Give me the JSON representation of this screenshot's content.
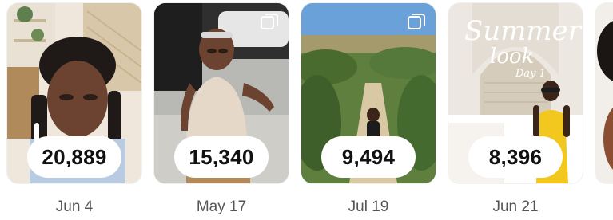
{
  "posts": [
    {
      "count": "20,889",
      "date": "Jun 4",
      "multi": false,
      "overlay": null
    },
    {
      "count": "15,340",
      "date": "May 17",
      "multi": true,
      "overlay": null
    },
    {
      "count": "9,494",
      "date": "Jul 19",
      "multi": true,
      "overlay": null
    },
    {
      "count": "8,396",
      "date": "Jun 21",
      "multi": false,
      "overlay": {
        "line1": "Summer",
        "line2": "look",
        "line3": "Day 1"
      }
    },
    {
      "count": "",
      "date": "",
      "multi": false,
      "overlay": null
    }
  ],
  "icons": {
    "multi": "carousel-icon"
  }
}
